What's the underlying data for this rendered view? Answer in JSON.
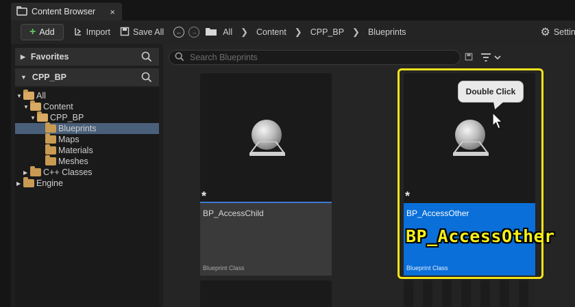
{
  "window": {
    "tab_title": "Content Browser",
    "tab_close": "×"
  },
  "toolbar": {
    "add_label": "Add",
    "import_label": "Import",
    "save_all_label": "Save All",
    "breadcrumbs": [
      "All",
      "Content",
      "CPP_BP",
      "Blueprints"
    ],
    "settings_label": "Settings"
  },
  "sidebar": {
    "favorites_label": "Favorites",
    "project_label": "CPP_BP",
    "tree": [
      {
        "label": "All",
        "depth": 0,
        "expanded": true,
        "selected": false
      },
      {
        "label": "Content",
        "depth": 1,
        "expanded": true,
        "selected": false
      },
      {
        "label": "CPP_BP",
        "depth": 2,
        "expanded": true,
        "selected": false
      },
      {
        "label": "Blueprints",
        "depth": 3,
        "expanded": false,
        "selected": true
      },
      {
        "label": "Maps",
        "depth": 3,
        "expanded": false,
        "selected": false
      },
      {
        "label": "Materials",
        "depth": 3,
        "expanded": false,
        "selected": false
      },
      {
        "label": "Meshes",
        "depth": 3,
        "expanded": false,
        "selected": false
      },
      {
        "label": "C++ Classes",
        "depth": 1,
        "expanded": false,
        "selected": false
      },
      {
        "label": "Engine",
        "depth": 1,
        "expanded": false,
        "selected": false
      }
    ]
  },
  "content": {
    "search_placeholder": "Search Blueprints",
    "assets": [
      {
        "name": "BP_AccessChild",
        "type": "Blueprint Class",
        "modified_marker": "*"
      },
      {
        "name": "BP_AccessOther",
        "type": "Blueprint Class",
        "modified_marker": "*"
      }
    ]
  },
  "annotation": {
    "bubble_text": "Double Click",
    "overlay_text": "BP_AccessOther",
    "highlight_color": "#f5e41a"
  },
  "colors": {
    "selection_blue": "#0a6fd8",
    "tree_selection": "#4a5f79",
    "add_green": "#5fc85f"
  }
}
